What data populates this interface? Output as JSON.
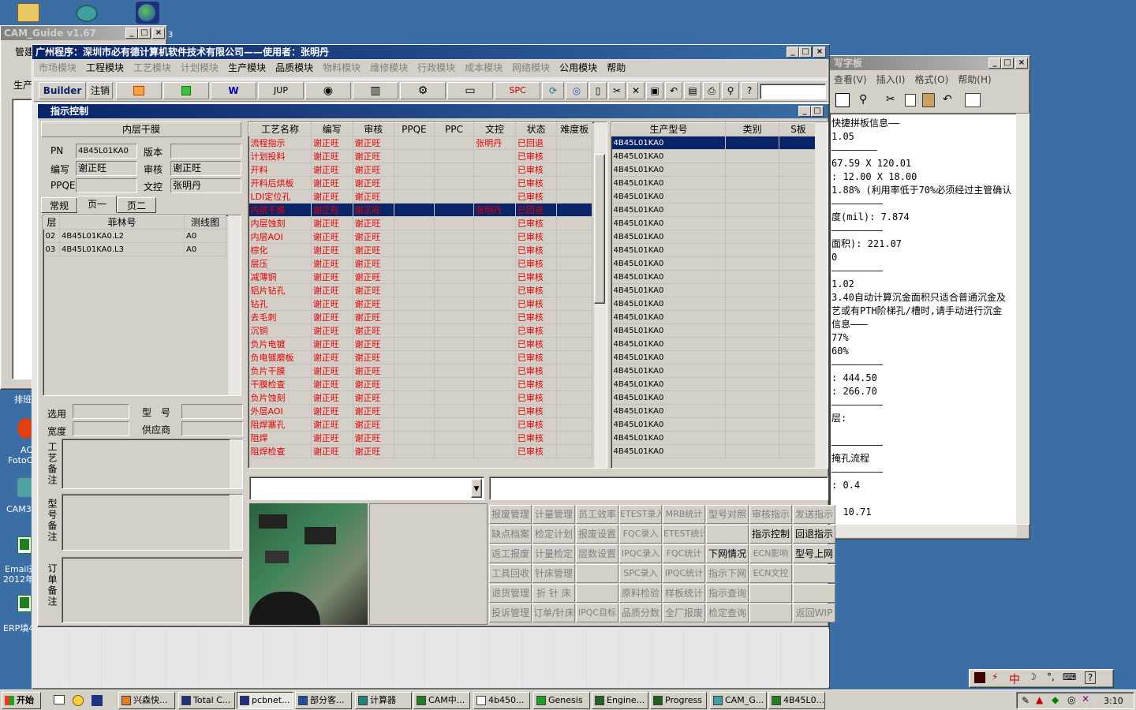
{
  "desktop": {
    "icon_labels": [
      "AC",
      "FotoC",
      "CAM35",
      "Email通",
      "2012年",
      "ERP填4",
      "排班"
    ],
    "taskbar_text_left": "管建",
    "side_text": "生产"
  },
  "cam_guide": {
    "title": "CAM_Guide v1.67",
    "trail": "3"
  },
  "main": {
    "title": "广州程序：深圳市必有德计算机软件技术有限公司——使用者：张明丹",
    "menu": [
      {
        "label": "市场模块",
        "enabled": false
      },
      {
        "label": "工程模块",
        "enabled": true
      },
      {
        "label": "工艺模块",
        "enabled": false
      },
      {
        "label": "计划模块",
        "enabled": false
      },
      {
        "label": "生产模块",
        "enabled": true
      },
      {
        "label": "品质模块",
        "enabled": true
      },
      {
        "label": "物料模块",
        "enabled": false
      },
      {
        "label": "维修模块",
        "enabled": false
      },
      {
        "label": "行政模块",
        "enabled": false
      },
      {
        "label": "成本模块",
        "enabled": false
      },
      {
        "label": "网络模块",
        "enabled": false
      },
      {
        "label": "公用模块",
        "enabled": true
      },
      {
        "label": "帮助",
        "enabled": true
      }
    ],
    "toolbar": {
      "builder": "Builder",
      "logout": "注销",
      "jup": "JUP",
      "spc": "SPC"
    }
  },
  "child": {
    "title": "指示控制",
    "layer_title": "内层干膜",
    "pn_label": "PN",
    "pn_value": "4B45L01KA0",
    "version_label": "版本",
    "version_value": "",
    "author_label": "编写",
    "author_value": "谢正旺",
    "review_label": "审核",
    "review_value": "谢正旺",
    "ppqe_label": "PPQE",
    "ppqe_value": "",
    "dc_label": "文控",
    "dc_value": "张明丹",
    "tabs": [
      "常规",
      "页一",
      "页二"
    ],
    "film_headers": [
      "层",
      "菲林号",
      "测线图"
    ],
    "film_rows": [
      [
        "02",
        "4B45L01KA0.L2",
        "A0"
      ],
      [
        "03",
        "4B45L01KA0.L3",
        "A0"
      ]
    ],
    "select_label": "选用",
    "model_label": "型　号",
    "width_label": "宽度",
    "supplier_label": "供应商",
    "note1": "工艺备注",
    "note2": "型号备注",
    "note3": "订单备注",
    "proc_headers": [
      "工艺名称",
      "编写",
      "审核",
      "PPQE",
      "PPC",
      "文控",
      "状态",
      "难度板"
    ],
    "proc_rows": [
      [
        "流程指示",
        "谢正旺",
        "谢正旺",
        "",
        "",
        "张明丹",
        "已回退",
        ""
      ],
      [
        "计划投料",
        "谢正旺",
        "谢正旺",
        "",
        "",
        "",
        "已审核",
        ""
      ],
      [
        "开料",
        "谢正旺",
        "谢正旺",
        "",
        "",
        "",
        "已审核",
        ""
      ],
      [
        "开料后烘板",
        "谢正旺",
        "谢正旺",
        "",
        "",
        "",
        "已审核",
        ""
      ],
      [
        "LDI定位孔",
        "谢正旺",
        "谢正旺",
        "",
        "",
        "",
        "已审核",
        ""
      ],
      [
        "内层干膜",
        "谢正旺",
        "谢正旺",
        "",
        "",
        "张明丹",
        "已回退",
        ""
      ],
      [
        "内层蚀刻",
        "谢正旺",
        "谢正旺",
        "",
        "",
        "",
        "已审核",
        ""
      ],
      [
        "内层AOI",
        "谢正旺",
        "谢正旺",
        "",
        "",
        "",
        "已审核",
        ""
      ],
      [
        "棕化",
        "谢正旺",
        "谢正旺",
        "",
        "",
        "",
        "已审核",
        ""
      ],
      [
        "层压",
        "谢正旺",
        "谢正旺",
        "",
        "",
        "",
        "已审核",
        ""
      ],
      [
        "减薄铜",
        "谢正旺",
        "谢正旺",
        "",
        "",
        "",
        "已审核",
        ""
      ],
      [
        "铝片钻孔",
        "谢正旺",
        "谢正旺",
        "",
        "",
        "",
        "已审核",
        ""
      ],
      [
        "钻孔",
        "谢正旺",
        "谢正旺",
        "",
        "",
        "",
        "已审核",
        ""
      ],
      [
        "去毛刺",
        "谢正旺",
        "谢正旺",
        "",
        "",
        "",
        "已审核",
        ""
      ],
      [
        "沉铜",
        "谢正旺",
        "谢正旺",
        "",
        "",
        "",
        "已审核",
        ""
      ],
      [
        "负片电镀",
        "谢正旺",
        "谢正旺",
        "",
        "",
        "",
        "已审核",
        ""
      ],
      [
        "负电镀磨板",
        "谢正旺",
        "谢正旺",
        "",
        "",
        "",
        "已审核",
        ""
      ],
      [
        "负片干膜",
        "谢正旺",
        "谢正旺",
        "",
        "",
        "",
        "已审核",
        ""
      ],
      [
        "干膜检查",
        "谢正旺",
        "谢正旺",
        "",
        "",
        "",
        "已审核",
        ""
      ],
      [
        "负片蚀刻",
        "谢正旺",
        "谢正旺",
        "",
        "",
        "",
        "已审核",
        ""
      ],
      [
        "外层AOI",
        "谢正旺",
        "谢正旺",
        "",
        "",
        "",
        "已审核",
        ""
      ],
      [
        "阻焊塞孔",
        "谢正旺",
        "谢正旺",
        "",
        "",
        "",
        "已审核",
        ""
      ],
      [
        "阻焊",
        "谢正旺",
        "谢正旺",
        "",
        "",
        "",
        "已审核",
        ""
      ],
      [
        "阻焊检查",
        "谢正旺",
        "谢正旺",
        "",
        "",
        "",
        "已审核",
        ""
      ]
    ],
    "model_headers": [
      "生产型号",
      "类别",
      "S板"
    ],
    "model_value": "4B45L01KA0",
    "model_row_count": 24,
    "buttons": [
      [
        "报废管理",
        "计量管理",
        "员工效率",
        "ETEST录入",
        "MRB统计",
        "型号对照",
        "审核指示",
        "发送指示"
      ],
      [
        "缺点档案",
        "检定计划",
        "报废设置",
        "FQC录入",
        "ETEST统计",
        "",
        "指示控制",
        "回退指示"
      ],
      [
        "返工报废",
        "计量检定",
        "层数设置",
        "IPQC录入",
        "FQC统计",
        "下网情况",
        "ECN影响",
        "型号上网"
      ],
      [
        "工具回收",
        "针床管理",
        "",
        "SPC录入",
        "IPQC统计",
        "指示下网",
        "ECN文控",
        ""
      ],
      [
        "退货管理",
        "折 针 床",
        "",
        "原料检验",
        "样板统计",
        "指示查询",
        "",
        ""
      ],
      [
        "投诉管理",
        "订单/针床",
        "IPQC目标",
        "品质分数",
        "全厂报废",
        "检定查询",
        "",
        "返回WIP"
      ]
    ],
    "enabled_buttons": [
      "下网情况",
      "指示控制",
      "回退指示",
      "型号上网"
    ]
  },
  "notepad": {
    "title": "写字板",
    "menu": [
      "查看(V)",
      "插入(I)",
      "格式(O)",
      "帮助(H)"
    ],
    "lines": [
      "快捷拼板信息——",
      "1.05",
      "————————",
      "67.59 X 120.01",
      ": 12.00 X 18.00",
      "1.88% (利用率低于70%必须经过主管确认",
      "—————————",
      "度(mil): 7.874",
      "—————————",
      "面积): 221.07",
      "0",
      "—————————",
      "1.02",
      "3.40自动计算沉金面积只适合普通沉金及",
      "艺或有PTH阶梯孔/槽时,请手动进行沉金",
      "信息———",
      "77%",
      "60%",
      "—————————",
      ": 444.50",
      ": 266.70",
      "—————————",
      "层:",
      "",
      "—————————",
      "掩孔流程",
      "—————————",
      ": 0.4",
      "",
      "· 10.71"
    ]
  },
  "ime": {
    "lang": "中"
  },
  "taskbar": {
    "start": "开始",
    "buttons": [
      "兴森快...",
      "Total C...",
      "pcbnet...",
      "部分客...",
      "计算器",
      "CAM中...",
      "4b450...",
      "Genesis",
      "Engine...",
      "Progress",
      "CAM_G...",
      "4B45L0..."
    ],
    "clock": "3:10"
  }
}
